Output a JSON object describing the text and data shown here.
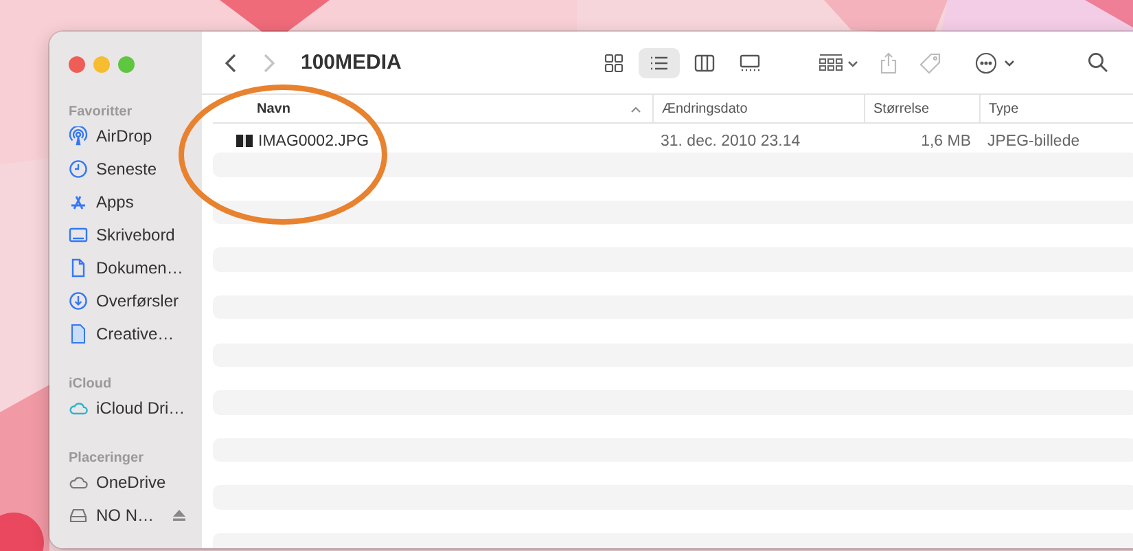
{
  "window": {
    "title": "100MEDIA",
    "traffic_lights": [
      {
        "color": "#ee5e57"
      },
      {
        "color": "#f5bd2f"
      },
      {
        "color": "#5fc63f"
      }
    ]
  },
  "navigation": {
    "back_disabled": false,
    "forward_disabled": true
  },
  "view_buttons": [
    {
      "kind": "icons",
      "selected": false
    },
    {
      "kind": "list",
      "selected": true
    },
    {
      "kind": "columns",
      "selected": false
    },
    {
      "kind": "gallery",
      "selected": false
    }
  ],
  "sidebar": {
    "sections": [
      {
        "heading": "Favoritter",
        "items": [
          {
            "label": "AirDrop",
            "kind": "airdrop",
            "eject": false
          },
          {
            "label": "Seneste",
            "kind": "clock",
            "eject": false
          },
          {
            "label": "Apps",
            "kind": "apps",
            "eject": false
          },
          {
            "label": "Skrivebord",
            "kind": "desktop",
            "eject": false
          },
          {
            "label": "Dokumen…",
            "kind": "document",
            "eject": false
          },
          {
            "label": "Overførsler",
            "kind": "download",
            "eject": false
          },
          {
            "label": "Creative…",
            "kind": "file",
            "eject": false
          }
        ]
      },
      {
        "heading": "iCloud",
        "items": [
          {
            "label": "iCloud Dri…",
            "kind": "cloud",
            "eject": false
          }
        ]
      },
      {
        "heading": "Placeringer",
        "items": [
          {
            "label": "OneDrive",
            "kind": "cloud-plain",
            "eject": false
          },
          {
            "label": "NO N…",
            "kind": "drive",
            "eject": true
          }
        ]
      }
    ]
  },
  "table": {
    "columns": [
      {
        "label": "Navn",
        "sorted": true
      },
      {
        "label": "Ændringsdato",
        "sorted": false
      },
      {
        "label": "Størrelse",
        "sorted": false
      },
      {
        "label": "Type",
        "sorted": false
      }
    ],
    "rows": [
      {
        "name": "IMAG0002.JPG",
        "date": "31. dec. 2010 23.14",
        "size": "1,6 MB",
        "type": "JPEG-billede"
      }
    ]
  },
  "annotations": [
    {
      "kind": "ellipse"
    }
  ]
}
